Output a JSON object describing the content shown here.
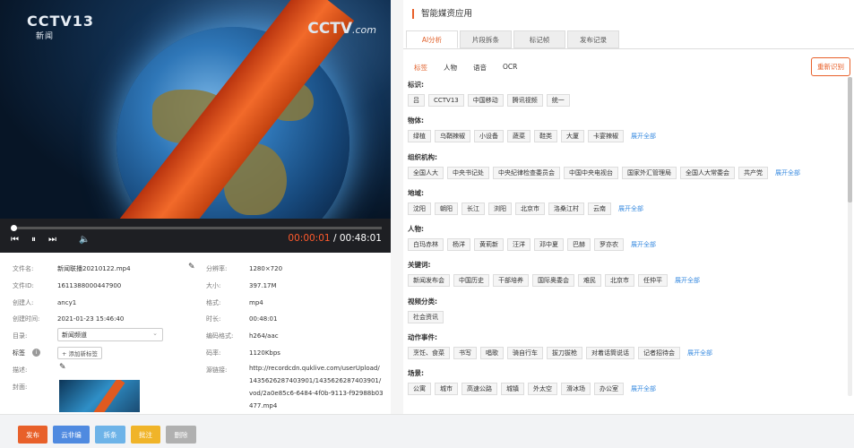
{
  "player": {
    "logo_left": "CCTV13",
    "logo_left_sub": "新闻",
    "logo_right": "CCTV",
    "logo_right_suffix": ".com",
    "current_time": "00:00:01",
    "separator": "/",
    "total_time": "00:48:01",
    "progress": 0.006
  },
  "meta": {
    "file_name_label": "文件名:",
    "file_name": "新闻联播20210122.mp4",
    "file_id_label": "文件ID:",
    "file_id": "1611388000447900",
    "creator_label": "创建人:",
    "creator": "ancy1",
    "created_label": "创建时间:",
    "created": "2021-01-23 15:46:40",
    "dir_label": "目录:",
    "dir_value": "新闻频道",
    "tags_label": "标签",
    "tag_add": "+ 添加新标签",
    "desc_label": "描述:",
    "cover_label": "封面:",
    "resolution_label": "分辨率:",
    "resolution": "1280×720",
    "size_label": "大小:",
    "size": "397.17M",
    "format_label": "格式:",
    "format": "mp4",
    "duration_label": "时长:",
    "duration": "00:48:01",
    "codec_label": "编码格式:",
    "codec": "h264/aac",
    "bitrate_label": "码率:",
    "bitrate": "1120Kbps",
    "source_label": "源链接:",
    "source": "http://recordcdn.quklive.com/userUpload/1435626287403901/1435626287403901/vod/2a0e85c6-6484-4f0b-9113-f92988b03477.mp4"
  },
  "actions": {
    "publish": "发布",
    "cloud_edit": "云非编",
    "split": "拆条",
    "annotate": "批注",
    "delete": "删除"
  },
  "panel": {
    "title": "智能媒资应用",
    "tabs": [
      "AI分析",
      "片段拆条",
      "标记帧",
      "发布记录"
    ],
    "subtabs": [
      "标签",
      "人物",
      "语音",
      "OCR"
    ],
    "rerun": "重新识别",
    "expand": "展开全部"
  },
  "sections": [
    {
      "title": "标识:",
      "chips": [
        "吕",
        "CCTV13",
        "中国移动",
        "腾讯视频",
        "统一"
      ],
      "more": false
    },
    {
      "title": "物体:",
      "chips": [
        "绿植",
        "乌鞘辣椒",
        "小设备",
        "蔬菜",
        "鞋类",
        "大厦",
        "卡宴辣椒"
      ],
      "more": true
    },
    {
      "title": "组织机构:",
      "chips": [
        "全国人大",
        "中央书记处",
        "中央纪律检查委员会",
        "中国中央电视台",
        "国家外汇管理局",
        "全国人大常委会",
        "共产党"
      ],
      "more": true
    },
    {
      "title": "地域:",
      "chips": [
        "沈阳",
        "朝阳",
        "长江",
        "浏阳",
        "北京市",
        "洛桑江村",
        "云南"
      ],
      "more": true
    },
    {
      "title": "人物:",
      "chips": [
        "白玛赤林",
        "杨洋",
        "黄莉新",
        "汪洋",
        "邓中夏",
        "巴赫",
        "罗亦农"
      ],
      "more": true
    },
    {
      "title": "关键词:",
      "chips": [
        "新闻发布会",
        "中国历史",
        "干部培养",
        "国际奥委会",
        "难民",
        "北京市",
        "任仲平"
      ],
      "more": true
    },
    {
      "title": "视频分类:",
      "chips": [
        "社会资讯"
      ],
      "more": false
    },
    {
      "title": "动作事件:",
      "chips": [
        "烹饪、食菜",
        "书写",
        "唱歌",
        "骑自行车",
        "拔刀拔枪",
        "对着话筒说话",
        "记者招待会"
      ],
      "more": true
    },
    {
      "title": "场景:",
      "chips": [
        "公寓",
        "城市",
        "高速公路",
        "城镇",
        "外太空",
        "滑冰场",
        "办公室"
      ],
      "more": true
    }
  ],
  "colors": {
    "accent": "#e8602a",
    "link": "#3b8ce0",
    "publish": "#e8602a",
    "cloud": "#4f8ae0",
    "split": "#6db3e8",
    "annotate": "#f0b429",
    "delete": "#b0b0b0"
  }
}
